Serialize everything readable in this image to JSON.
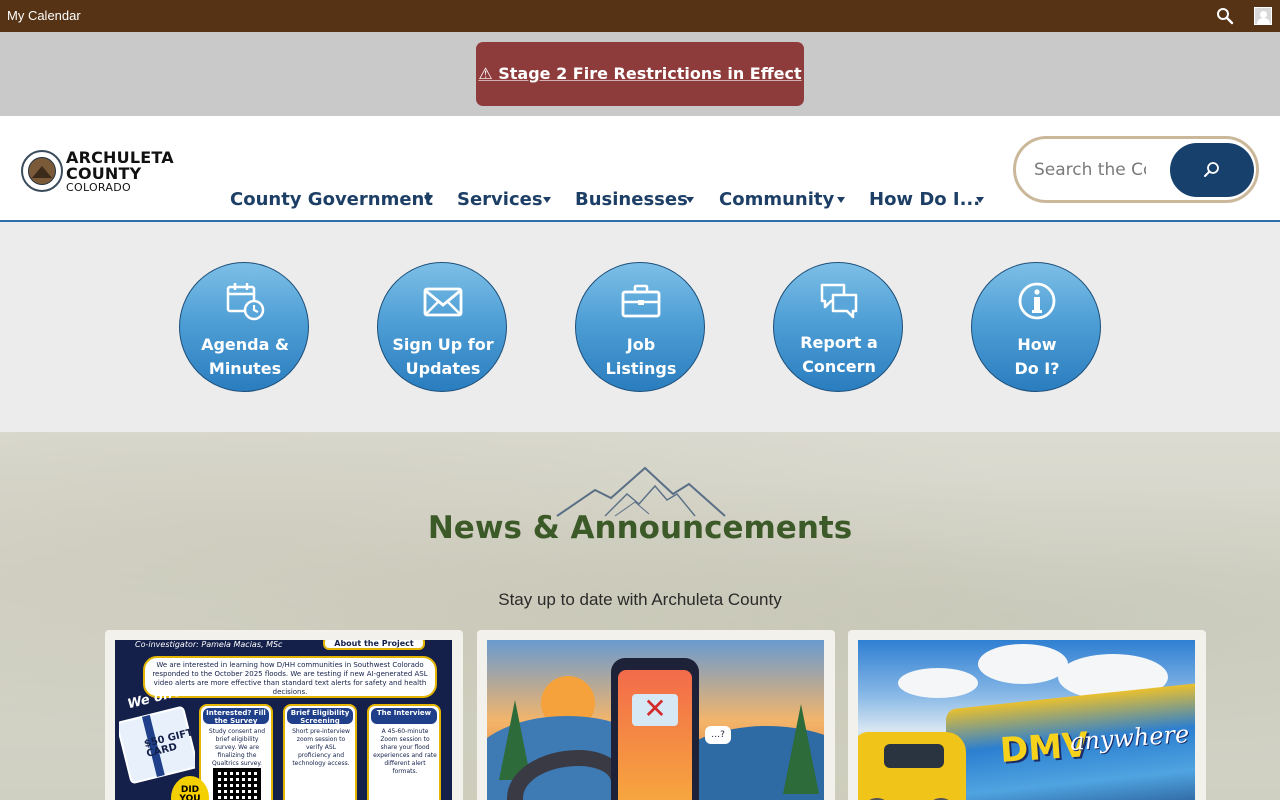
{
  "topbar": {
    "calendar_label": "My Calendar",
    "search_icon": "search-icon",
    "user_icon": "user-icon"
  },
  "alert": {
    "text": "⚠ Stage 2 Fire Restrictions in Effect",
    "color": "#8e3b3c"
  },
  "header": {
    "logo": {
      "line1": "ARCHULETA",
      "line2": "COUNTY",
      "line3": "COLORADO"
    },
    "nav": [
      {
        "label": "County Government"
      },
      {
        "label": "Services"
      },
      {
        "label": "Businesses"
      },
      {
        "label": "Community"
      },
      {
        "label": "How Do I..."
      }
    ],
    "search": {
      "placeholder": "Search the County",
      "button_icon": "search-icon"
    }
  },
  "quicklinks": [
    {
      "line1": "Agenda &",
      "line2": "Minutes",
      "icon": "calendar-clock-icon"
    },
    {
      "line1": "Sign Up for",
      "line2": "Updates",
      "icon": "envelope-icon"
    },
    {
      "line1": "Job",
      "line2": "Listings",
      "icon": "briefcase-icon"
    },
    {
      "line1": "Report a",
      "line2": "Concern",
      "icon": "chat-bubbles-icon"
    },
    {
      "line1": "How",
      "line2": "Do I?",
      "icon": "info-icon"
    }
  ],
  "news": {
    "title": "News & Announcements",
    "subtitle": "Stay up to date with Archuleta County",
    "cards": [
      {
        "flyer": {
          "investigator": "Co-investigator: Pamela Macias, MSc",
          "tab": "About the Project",
          "blurb": "We are interested in learning how D/HH communities in Southwest Colorado responded to the October 2025 floods. We are testing if new AI-generated ASL video alerts are more effective than standard text alerts for safety and health decisions.",
          "offer": "We offer",
          "gift": "$50 GIFT CARD",
          "columns": [
            {
              "head": "Interested? Fill the Survey",
              "text": "Study consent and brief eligibility survey. We are finalizing the Qualtrics survey."
            },
            {
              "head": "Brief Eligibility Screening",
              "text": "Short pre-interview zoom session to verify ASL proficiency and technology access."
            },
            {
              "head": "The Interview",
              "text": "A 45-60-minute Zoom session to share your flood experiences and rate different alert formats."
            }
          ],
          "badge": "DID YOU"
        }
      },
      {
        "icon": "scam-phone-illustration"
      },
      {
        "dmv": "DMV",
        "anywhere": "anywhere"
      }
    ]
  }
}
